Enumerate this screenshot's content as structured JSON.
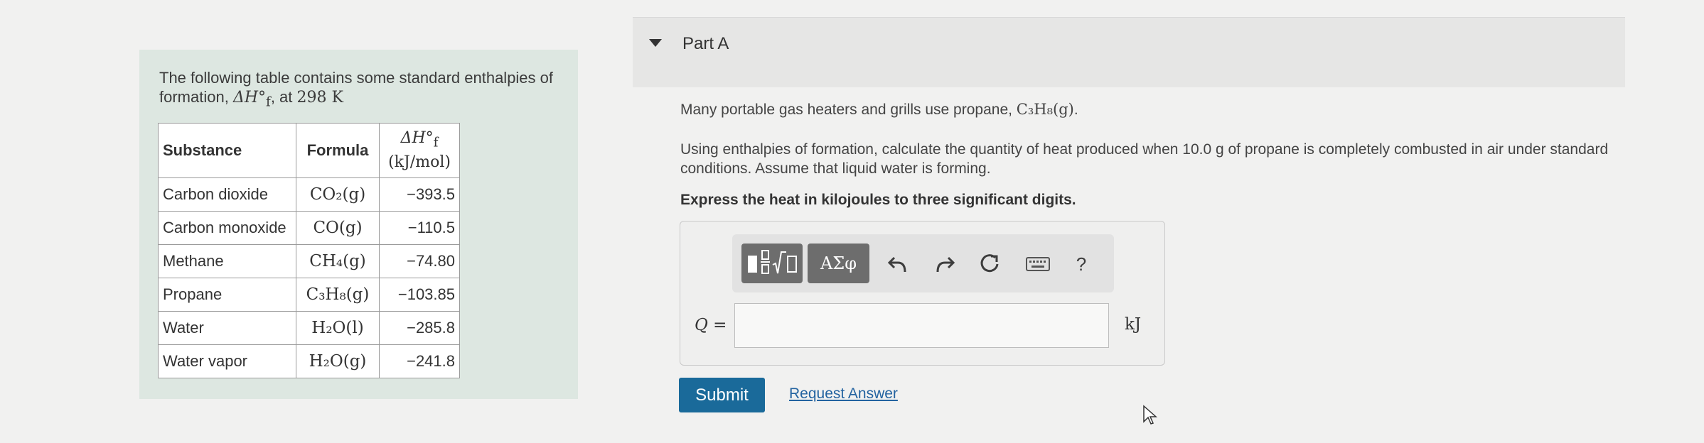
{
  "intro": {
    "text_before": "The following table contains some standard enthalpies of formation, ",
    "symbol": "ΔH°",
    "subscript": "f",
    "text_after": ", at ",
    "temperature": "298 K"
  },
  "table": {
    "headers": {
      "substance": "Substance",
      "formula": "Formula",
      "enthalpy_symbol": "ΔH°",
      "enthalpy_sub": "f",
      "enthalpy_unit": "(kJ/mol)"
    },
    "rows": [
      {
        "substance": "Carbon dioxide",
        "formula": "CO₂(g)",
        "value": "−393.5"
      },
      {
        "substance": "Carbon monoxide",
        "formula": "CO(g)",
        "value": "−110.5"
      },
      {
        "substance": "Methane",
        "formula": "CH₄(g)",
        "value": "−74.80"
      },
      {
        "substance": "Propane",
        "formula": "C₃H₈(g)",
        "value": "−103.85"
      },
      {
        "substance": "Water",
        "formula": "H₂O(l)",
        "value": "−285.8"
      },
      {
        "substance": "Water vapor",
        "formula": "H₂O(g)",
        "value": "−241.8"
      }
    ]
  },
  "part": {
    "title": "Part A",
    "question_line1": "Many portable gas heaters and grills use propane, ",
    "question_formula": "C₃H₈(g)",
    "question_line1_end": ".",
    "question_line2": "Using enthalpies of formation, calculate the quantity of heat produced when 10.0  g of propane is completely combusted in air under standard conditions. Assume that liquid water is forming.",
    "instruction": "Express the heat in kilojoules to three significant digits."
  },
  "toolbar": {
    "templates_icon": "templates-icon",
    "greek_label": "ΑΣφ",
    "undo_icon": "undo-icon",
    "redo_icon": "redo-icon",
    "reset_icon": "reset-icon",
    "keyboard_icon": "keyboard-icon",
    "help_label": "?"
  },
  "answer": {
    "variable": "Q",
    "equals": " =",
    "value": "",
    "unit": "kJ"
  },
  "actions": {
    "submit_label": "Submit",
    "request_label": "Request Answer"
  },
  "colors": {
    "panel_bg": "#dde7e1",
    "submit_bg": "#1a6a9a",
    "link": "#2363a0",
    "toolbar_button": "#6d6d6d"
  }
}
